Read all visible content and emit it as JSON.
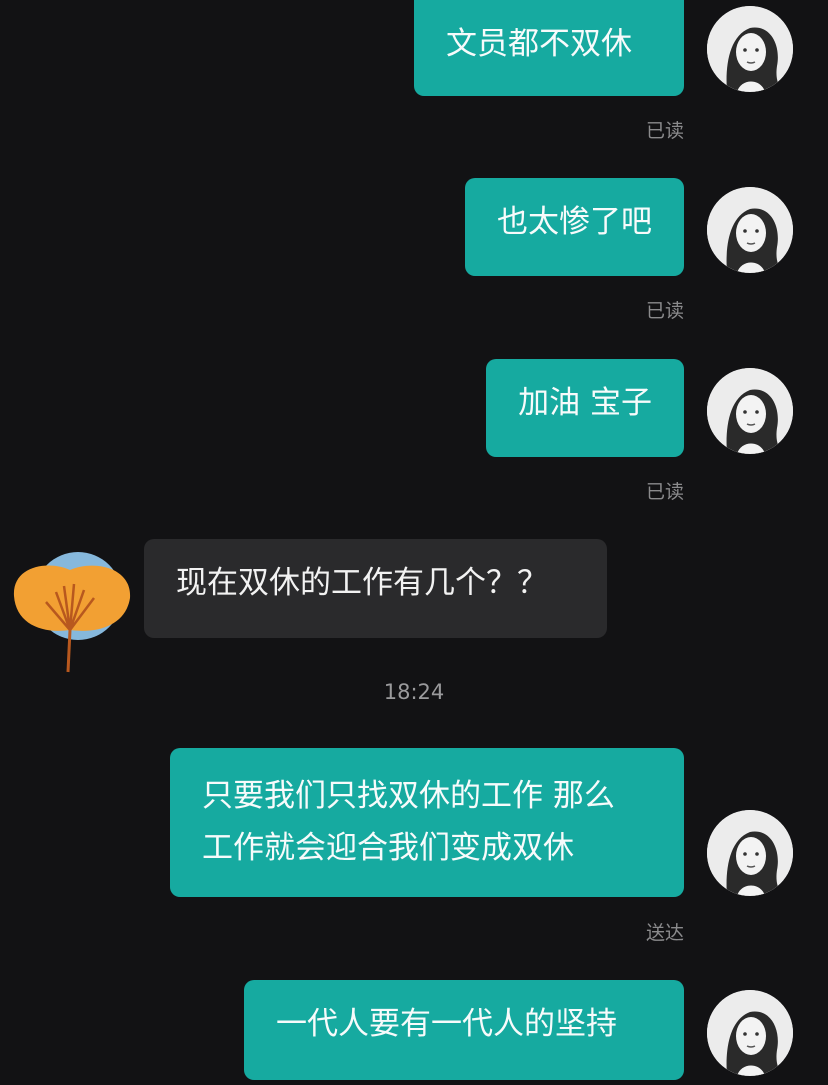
{
  "messages": [
    {
      "side": "out",
      "text": "文员都不双休",
      "status": "已读"
    },
    {
      "side": "out",
      "text": "也太惨了吧",
      "status": "已读"
    },
    {
      "side": "out",
      "text": "加油 宝子",
      "status": "已读"
    },
    {
      "side": "in",
      "text": "现在双休的工作有几个？？"
    },
    {
      "timestamp": "18:24"
    },
    {
      "side": "out",
      "lines": [
        "只要我们只找双休的工作 那么",
        "工作就会迎合我们变成双休"
      ],
      "status": "送达"
    },
    {
      "side": "out",
      "text": "一代人要有一代人的坚持"
    }
  ],
  "colors": {
    "background": "#121214",
    "outgoing_bubble": "#16aaa0",
    "incoming_bubble": "#2a2a2c",
    "status_text": "#8a8a8c"
  },
  "icons": {
    "self_avatar": "portrait-avatar",
    "contact_avatar": "ginkgo-leaf-avatar"
  }
}
